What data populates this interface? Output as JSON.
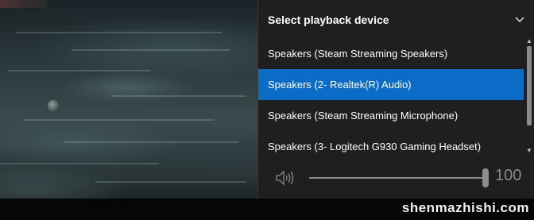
{
  "flyout": {
    "title": "Select playback device",
    "devices": [
      {
        "label": "Speakers (Steam Streaming Speakers)",
        "selected": false
      },
      {
        "label": "Speakers (2- Realtek(R) Audio)",
        "selected": true
      },
      {
        "label": "Speakers (Steam Streaming Microphone)",
        "selected": false
      },
      {
        "label": "Speakers (3- Logitech G930 Gaming Headset)",
        "selected": false
      }
    ],
    "volume": {
      "value": "100",
      "level": 1.0,
      "icon": "speaker-volume-icon"
    },
    "collapse_icon": "chevron-down-icon"
  },
  "watermark": {
    "text": "shenmazhishi.com"
  },
  "colors": {
    "flyout_bg": "#1f1f1f",
    "selected_bg": "#0a6cc6",
    "text": "#ffffff",
    "muted": "#8a8a8a"
  }
}
